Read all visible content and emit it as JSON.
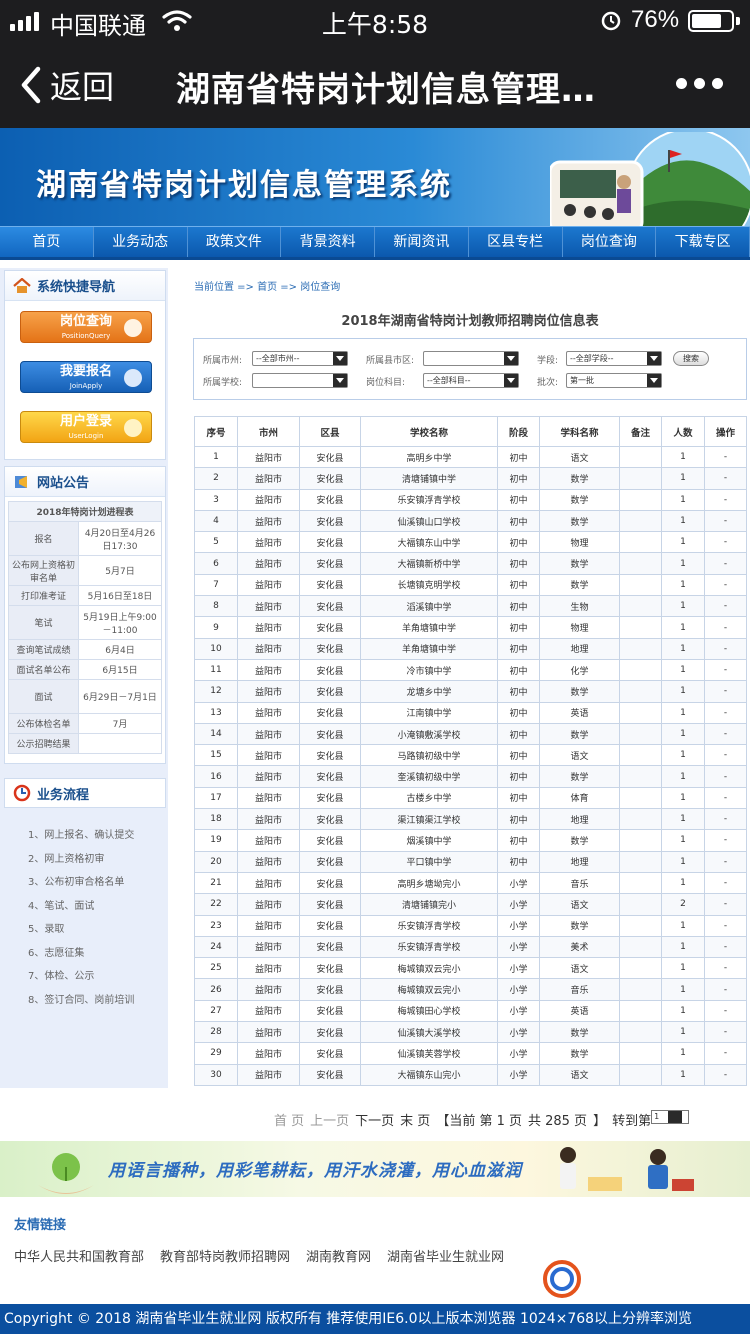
{
  "status_bar": {
    "carrier": "中国联通",
    "time": "上午8:58",
    "battery": "76%",
    "battery_level": 0.76
  },
  "nav": {
    "back_label": "返回",
    "title": "湖南省特岗计划信息管理…"
  },
  "banner": {
    "title": "湖南省特岗计划信息管理系统"
  },
  "menu": [
    "首页",
    "业务动态",
    "政策文件",
    "背景资料",
    "新闻资讯",
    "区县专栏",
    "岗位查询",
    "下载专区"
  ],
  "sidebar": {
    "quick_nav_title": "系统快捷导航",
    "buttons": [
      {
        "label": "岗位查询",
        "sub": "PositionQuery"
      },
      {
        "label": "我要报名",
        "sub": "JoinApply"
      },
      {
        "label": "用户登录",
        "sub": "UserLogin"
      }
    ],
    "notice_title": "网站公告",
    "notice_table_title": "2018年特岗计划进程表",
    "notice_rows": [
      {
        "k": "报名",
        "v": "4月20日至4月26日17:30"
      },
      {
        "k": "公布网上资格初审名单",
        "v": "5月7日"
      },
      {
        "k": "打印准考证",
        "v": "5月16日至18日"
      },
      {
        "k": "笔试",
        "v": "5月19日上午9:00－11:00"
      },
      {
        "k": "查询笔试成绩",
        "v": "6月4日"
      },
      {
        "k": "面试名单公布",
        "v": "6月15日"
      },
      {
        "k": "面试",
        "v": "6月29日－7月1日"
      },
      {
        "k": "公布体检名单",
        "v": "7月"
      },
      {
        "k": "公示招聘结果",
        "v": ""
      }
    ],
    "flow_title": "业务流程",
    "flow_items": [
      "1、网上报名、确认提交",
      "2、网上资格初审",
      "3、公布初审合格名单",
      "4、笔试、面试",
      "5、录取",
      "6、志愿征集",
      "7、体检、公示",
      "8、签订合同、岗前培训"
    ]
  },
  "main": {
    "breadcrumb": "当前位置 => 首页 => 岗位查询",
    "title": "2018年湖南省特岗计划教师招聘岗位信息表",
    "filters": {
      "city_label": "所属市州:",
      "city_value": "--全部市州--",
      "county_label": "所属县市区:",
      "county_value": "",
      "stage_label": "学段:",
      "stage_value": "--全部学段--",
      "search_label": "搜索",
      "school_label": "所属学校:",
      "school_value": "",
      "subject_label": "岗位科目:",
      "subject_value": "--全部科目--",
      "batch_label": "批次:",
      "batch_value": "第一批"
    },
    "columns": [
      "序号",
      "市州",
      "区县",
      "学校名称",
      "阶段",
      "学科名称",
      "备注",
      "人数",
      "操作"
    ],
    "rows": [
      [
        "1",
        "益阳市",
        "安化县",
        "高明乡中学",
        "初中",
        "语文",
        "",
        "1",
        "-"
      ],
      [
        "2",
        "益阳市",
        "安化县",
        "清塘铺镇中学",
        "初中",
        "数学",
        "",
        "1",
        "-"
      ],
      [
        "3",
        "益阳市",
        "安化县",
        "乐安镇浮青学校",
        "初中",
        "数学",
        "",
        "1",
        "-"
      ],
      [
        "4",
        "益阳市",
        "安化县",
        "仙溪镇山口学校",
        "初中",
        "数学",
        "",
        "1",
        "-"
      ],
      [
        "5",
        "益阳市",
        "安化县",
        "大福镇东山中学",
        "初中",
        "物理",
        "",
        "1",
        "-"
      ],
      [
        "6",
        "益阳市",
        "安化县",
        "大福镇新桥中学",
        "初中",
        "数学",
        "",
        "1",
        "-"
      ],
      [
        "7",
        "益阳市",
        "安化县",
        "长塘镇克明学校",
        "初中",
        "数学",
        "",
        "1",
        "-"
      ],
      [
        "8",
        "益阳市",
        "安化县",
        "滔溪镇中学",
        "初中",
        "生物",
        "",
        "1",
        "-"
      ],
      [
        "9",
        "益阳市",
        "安化县",
        "羊角塘镇中学",
        "初中",
        "物理",
        "",
        "1",
        "-"
      ],
      [
        "10",
        "益阳市",
        "安化县",
        "羊角塘镇中学",
        "初中",
        "地理",
        "",
        "1",
        "-"
      ],
      [
        "11",
        "益阳市",
        "安化县",
        "冷市镇中学",
        "初中",
        "化学",
        "",
        "1",
        "-"
      ],
      [
        "12",
        "益阳市",
        "安化县",
        "龙塘乡中学",
        "初中",
        "数学",
        "",
        "1",
        "-"
      ],
      [
        "13",
        "益阳市",
        "安化县",
        "江南镇中学",
        "初中",
        "英语",
        "",
        "1",
        "-"
      ],
      [
        "14",
        "益阳市",
        "安化县",
        "小淹镇敷溪学校",
        "初中",
        "数学",
        "",
        "1",
        "-"
      ],
      [
        "15",
        "益阳市",
        "安化县",
        "马路镇初级中学",
        "初中",
        "语文",
        "",
        "1",
        "-"
      ],
      [
        "16",
        "益阳市",
        "安化县",
        "奎溪镇初级中学",
        "初中",
        "数学",
        "",
        "1",
        "-"
      ],
      [
        "17",
        "益阳市",
        "安化县",
        "古楼乡中学",
        "初中",
        "体育",
        "",
        "1",
        "-"
      ],
      [
        "18",
        "益阳市",
        "安化县",
        "渠江镇渠江学校",
        "初中",
        "地理",
        "",
        "1",
        "-"
      ],
      [
        "19",
        "益阳市",
        "安化县",
        "烟溪镇中学",
        "初中",
        "数学",
        "",
        "1",
        "-"
      ],
      [
        "20",
        "益阳市",
        "安化县",
        "平口镇中学",
        "初中",
        "地理",
        "",
        "1",
        "-"
      ],
      [
        "21",
        "益阳市",
        "安化县",
        "高明乡塘坳完小",
        "小学",
        "音乐",
        "",
        "1",
        "-"
      ],
      [
        "22",
        "益阳市",
        "安化县",
        "清塘铺镇完小",
        "小学",
        "语文",
        "",
        "2",
        "-"
      ],
      [
        "23",
        "益阳市",
        "安化县",
        "乐安镇浮青学校",
        "小学",
        "数学",
        "",
        "1",
        "-"
      ],
      [
        "24",
        "益阳市",
        "安化县",
        "乐安镇浮青学校",
        "小学",
        "美术",
        "",
        "1",
        "-"
      ],
      [
        "25",
        "益阳市",
        "安化县",
        "梅城镇双云完小",
        "小学",
        "语文",
        "",
        "1",
        "-"
      ],
      [
        "26",
        "益阳市",
        "安化县",
        "梅城镇双云完小",
        "小学",
        "音乐",
        "",
        "1",
        "-"
      ],
      [
        "27",
        "益阳市",
        "安化县",
        "梅城镇田心学校",
        "小学",
        "英语",
        "",
        "1",
        "-"
      ],
      [
        "28",
        "益阳市",
        "安化县",
        "仙溪镇大溪学校",
        "小学",
        "数学",
        "",
        "1",
        "-"
      ],
      [
        "29",
        "益阳市",
        "安化县",
        "仙溪镇芙蓉学校",
        "小学",
        "数学",
        "",
        "1",
        "-"
      ],
      [
        "30",
        "益阳市",
        "安化县",
        "大福镇东山完小",
        "小学",
        "语文",
        "",
        "1",
        "-"
      ]
    ],
    "pager": {
      "first": "首 页",
      "prev": "上一页",
      "next": "下一页",
      "last": "末 页",
      "current": "【当前 第 1 页",
      "total": "共 285 页",
      "close": "】",
      "goto": "转到第",
      "select_value": "1"
    }
  },
  "slogan": "用语言播种，用彩笔耕耘，用汗水浇灌，用心血滋润",
  "friend_links": {
    "title": "友情链接",
    "items": [
      "中华人民共和国教育部",
      "教育部特岗教师招聘网",
      "湖南教育网",
      "湖南省毕业生就业网"
    ]
  },
  "copyright": "Copyright © 2018 湖南省毕业生就业网 版权所有 推荐使用IE6.0以上版本浏览器 1024×768以上分辨率浏览"
}
